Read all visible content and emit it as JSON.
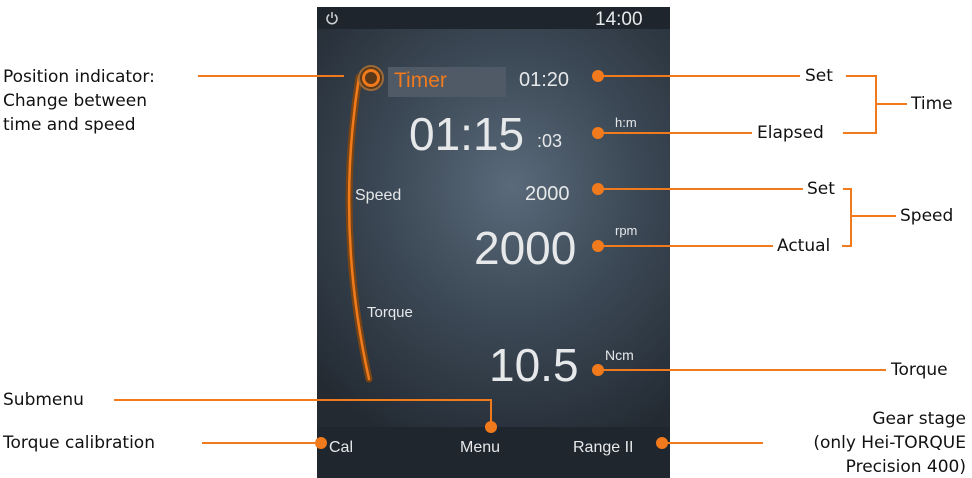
{
  "screen": {
    "status_time": "14:00",
    "timer_label": "Timer",
    "timer_set": "01:20",
    "elapsed_main": "01:15",
    "elapsed_seconds": ":03",
    "elapsed_unit": "h:m",
    "speed_label": "Speed",
    "speed_set": "2000",
    "speed_actual": "2000",
    "speed_unit": "rpm",
    "torque_label": "Torque",
    "torque_value": "10.5",
    "torque_unit": "Ncm",
    "bottom_left": "Cal",
    "bottom_center": "Menu",
    "bottom_right": "Range II"
  },
  "callouts": {
    "position_indicator": [
      "Position indicator:",
      "Change between",
      "time and speed"
    ],
    "set_time": "Set",
    "elapsed": "Elapsed",
    "time": "Time",
    "set_speed": "Set",
    "actual": "Actual",
    "speed": "Speed",
    "torque": "Torque",
    "submenu": "Submenu",
    "torque_calibration": "Torque calibration",
    "gear_stage": [
      "Gear stage",
      "(only Hei-TORQUE",
      "Precision 400)"
    ]
  },
  "colors": {
    "accent": "#f07a1c",
    "screen_bg": "#3d4a57",
    "screen_text": "#e6e8ea"
  },
  "icons": {
    "power": "power-icon"
  }
}
